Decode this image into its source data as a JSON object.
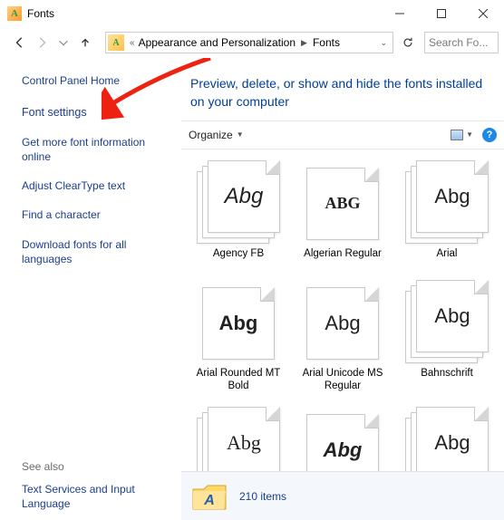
{
  "window": {
    "title": "Fonts"
  },
  "breadcrumbs": {
    "part1": "Appearance and Personalization",
    "part2": "Fonts"
  },
  "search": {
    "placeholder": "Search Fo..."
  },
  "sidebar": {
    "home": "Control Panel Home",
    "links": [
      "Font settings",
      "Get more font information online",
      "Adjust ClearType text",
      "Find a character",
      "Download fonts for all languages"
    ],
    "see_also_header": "See also",
    "see_also": "Text Services and Input Language"
  },
  "heading": "Preview, delete, or show and hide the fonts installed on your computer",
  "toolbar": {
    "organize": "Organize",
    "help": "?"
  },
  "fonts": {
    "row1": [
      {
        "sample": "Abg",
        "label": "Agency FB",
        "stack": "multi",
        "cls": "f-agency"
      },
      {
        "sample": "ABG",
        "label": "Algerian Regular",
        "stack": "single",
        "cls": "f-algerian"
      },
      {
        "sample": "Abg",
        "label": "Arial",
        "stack": "multi",
        "cls": "f-arial"
      }
    ],
    "row2": [
      {
        "sample": "Abg",
        "label": "Arial Rounded MT Bold",
        "stack": "single",
        "cls": "f-arialbold"
      },
      {
        "sample": "Abg",
        "label": "Arial Unicode MS Regular",
        "stack": "single",
        "cls": "f-uni"
      },
      {
        "sample": "Abg",
        "label": "Bahnschrift",
        "stack": "multi",
        "cls": "f-bahn"
      }
    ],
    "row3": [
      {
        "sample": "Abg",
        "label": "",
        "stack": "multi",
        "cls": "f-serif"
      },
      {
        "sample": "Abg",
        "label": "",
        "stack": "single",
        "cls": "f-fat"
      },
      {
        "sample": "Abg",
        "label": "",
        "stack": "multi",
        "cls": "f-arial"
      }
    ]
  },
  "status": {
    "count": "210 items"
  }
}
